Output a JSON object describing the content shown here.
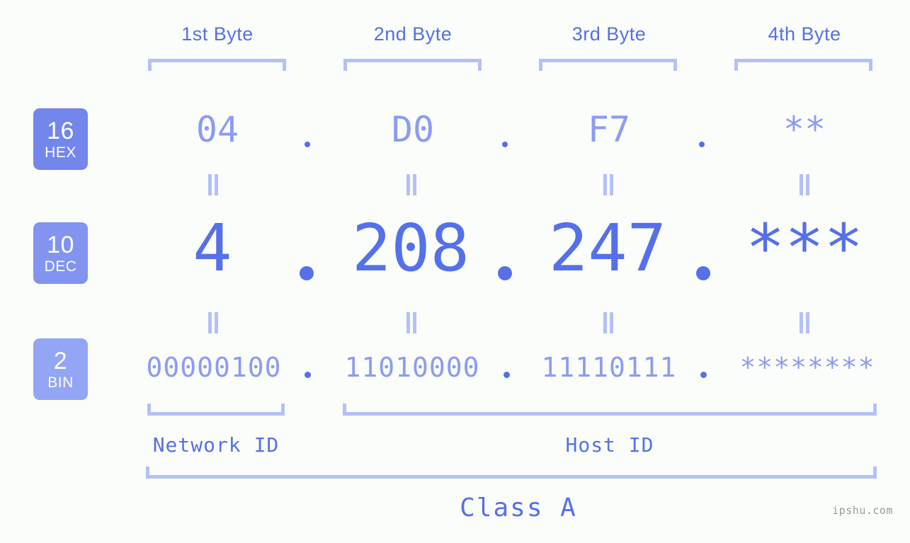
{
  "background_color": "#fbfdfa",
  "accent_color": "#5570e8",
  "accent_light_color": "#8c9cf2",
  "bracket_color": "#b4c0f7",
  "headers": {
    "bytes": [
      {
        "label": "1st Byte"
      },
      {
        "label": "2nd Byte"
      },
      {
        "label": "3rd Byte"
      },
      {
        "label": "4th Byte"
      }
    ]
  },
  "bases": [
    {
      "num": "16",
      "name": "HEX",
      "color": "#7286ec"
    },
    {
      "num": "10",
      "name": "DEC",
      "color": "#8294f0"
    },
    {
      "num": "2",
      "name": "BIN",
      "color": "#93a5f5"
    }
  ],
  "rows": {
    "hex": {
      "base_num": "16",
      "base_name": "HEX",
      "octets": [
        "04",
        "D0",
        "F7",
        "**"
      ],
      "separator": "."
    },
    "dec": {
      "base_num": "10",
      "base_name": "DEC",
      "octets": [
        "4",
        "208",
        "247",
        "***"
      ],
      "separator": "."
    },
    "bin": {
      "base_num": "2",
      "base_name": "BIN",
      "octets": [
        "00000100",
        "11010000",
        "11110111",
        "********"
      ],
      "separator": "."
    }
  },
  "equals_symbol": "=",
  "segments": {
    "network_id": "Network ID",
    "host_id": "Host ID",
    "class": "Class A"
  },
  "watermark": "ipshu.com"
}
